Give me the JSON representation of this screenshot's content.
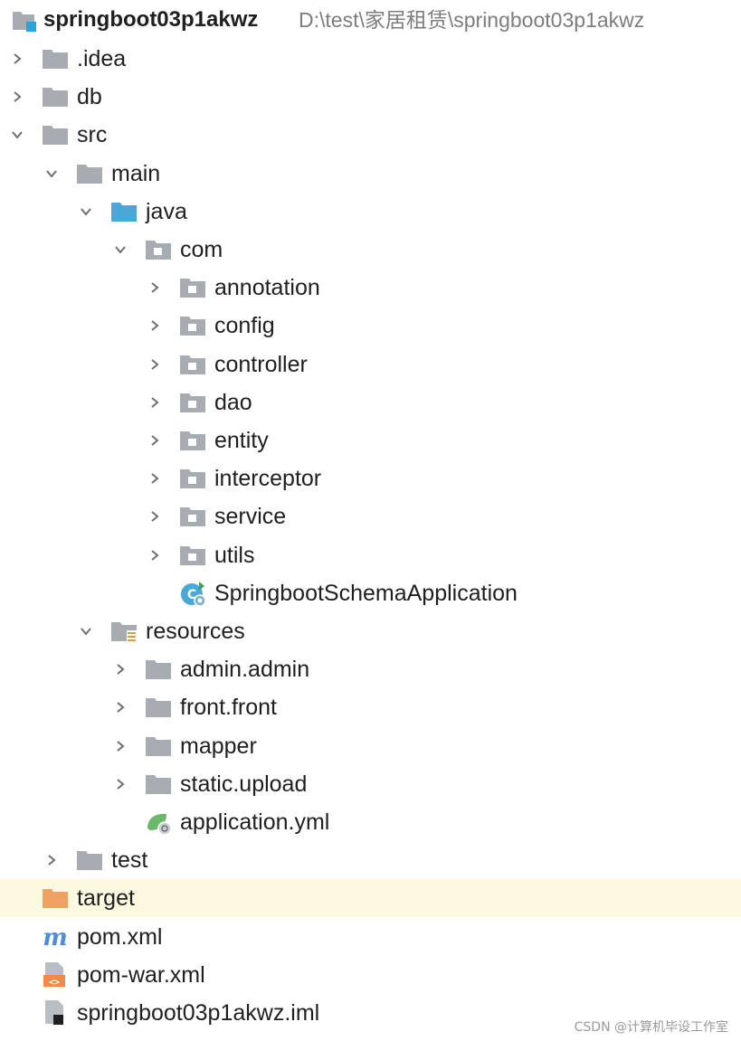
{
  "project": {
    "name": "springboot03p1akwz",
    "path": "D:\\test\\家居租赁\\springboot03p1akwz"
  },
  "rows": [
    {
      "label": ".idea",
      "icon": "folder-icon",
      "expand": "collapsed"
    },
    {
      "label": "db",
      "icon": "folder-icon",
      "expand": "collapsed"
    },
    {
      "label": "src",
      "icon": "folder-icon",
      "expand": "expanded"
    },
    {
      "label": "main",
      "icon": "folder-icon",
      "expand": "expanded"
    },
    {
      "label": "java",
      "icon": "source-folder-icon",
      "expand": "expanded"
    },
    {
      "label": "com",
      "icon": "package-icon",
      "expand": "expanded"
    },
    {
      "label": "annotation",
      "icon": "package-icon",
      "expand": "collapsed"
    },
    {
      "label": "config",
      "icon": "package-icon",
      "expand": "collapsed"
    },
    {
      "label": "controller",
      "icon": "package-icon",
      "expand": "collapsed"
    },
    {
      "label": "dao",
      "icon": "package-icon",
      "expand": "collapsed"
    },
    {
      "label": "entity",
      "icon": "package-icon",
      "expand": "collapsed"
    },
    {
      "label": "interceptor",
      "icon": "package-icon",
      "expand": "collapsed"
    },
    {
      "label": "service",
      "icon": "package-icon",
      "expand": "collapsed"
    },
    {
      "label": "utils",
      "icon": "package-icon",
      "expand": "collapsed"
    },
    {
      "label": "SpringbootSchemaApplication",
      "icon": "spring-boot-class-icon",
      "expand": "none"
    },
    {
      "label": "resources",
      "icon": "resources-folder-icon",
      "expand": "expanded"
    },
    {
      "label": "admin.admin",
      "icon": "folder-icon",
      "expand": "collapsed"
    },
    {
      "label": "front.front",
      "icon": "folder-icon",
      "expand": "collapsed"
    },
    {
      "label": "mapper",
      "icon": "folder-icon",
      "expand": "collapsed"
    },
    {
      "label": "static.upload",
      "icon": "folder-icon",
      "expand": "collapsed"
    },
    {
      "label": "application.yml",
      "icon": "spring-yml-icon",
      "expand": "none"
    },
    {
      "label": "test",
      "icon": "folder-icon",
      "expand": "collapsed"
    },
    {
      "label": "target",
      "icon": "excluded-folder-icon",
      "expand": "none"
    },
    {
      "label": "pom.xml",
      "icon": "maven-icon",
      "expand": "none"
    },
    {
      "label": "pom-war.xml",
      "icon": "xml-file-icon",
      "expand": "none"
    },
    {
      "label": "springboot03p1akwz.iml",
      "icon": "iml-file-icon",
      "expand": "none"
    }
  ],
  "colors": {
    "folder": "#a6acb2",
    "source_folder": "#4aa8d8",
    "excluded_folder": "#f0a060",
    "highlight_row": "#fdf9e1",
    "maven": "#4e8dd9"
  },
  "watermark": "CSDN @计算机毕设工作室"
}
